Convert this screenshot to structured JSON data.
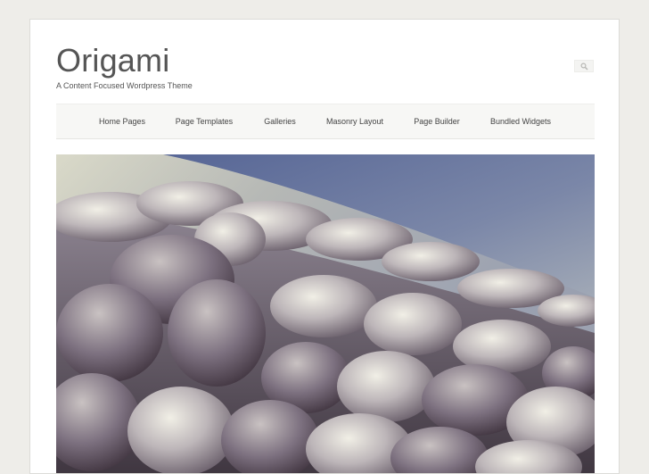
{
  "site": {
    "title": "Origami",
    "tagline": "A Content Focused Wordpress Theme"
  },
  "search": {
    "icon": "search-icon"
  },
  "nav": {
    "items": [
      {
        "label": "Home Pages"
      },
      {
        "label": "Page Templates"
      },
      {
        "label": "Galleries"
      },
      {
        "label": "Masonry Layout"
      },
      {
        "label": "Page Builder"
      },
      {
        "label": "Bundled Widgets"
      }
    ]
  },
  "hero": {
    "image": "clouds-above-earth-photo"
  },
  "colors": {
    "background": "#eeede9",
    "title": "#555555",
    "nav_background": "#f7f7f5",
    "sky_top": "#5c6794",
    "sky_bottom": "#b9c2c8"
  }
}
